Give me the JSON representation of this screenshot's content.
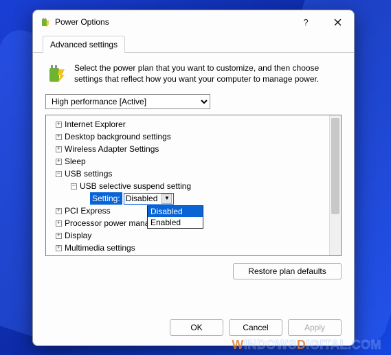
{
  "window": {
    "title": "Power Options"
  },
  "tab": {
    "label": "Advanced settings"
  },
  "description": "Select the power plan that you want to customize, and then choose settings that reflect how you want your computer to manage power.",
  "plan_select": {
    "value": "High performance [Active]"
  },
  "tree": {
    "items": [
      {
        "label": "Internet Explorer",
        "expanded": false,
        "depth": 0
      },
      {
        "label": "Desktop background settings",
        "expanded": false,
        "depth": 0
      },
      {
        "label": "Wireless Adapter Settings",
        "expanded": false,
        "depth": 0
      },
      {
        "label": "Sleep",
        "expanded": false,
        "depth": 0
      },
      {
        "label": "USB settings",
        "expanded": true,
        "depth": 0
      },
      {
        "label": "USB selective suspend setting",
        "expanded": true,
        "depth": 1
      },
      {
        "label": "PCI Express",
        "expanded": false,
        "depth": 0
      },
      {
        "label": "Processor power management",
        "expanded": false,
        "depth": 0
      },
      {
        "label": "Display",
        "expanded": false,
        "depth": 0
      },
      {
        "label": "Multimedia settings",
        "expanded": false,
        "depth": 0
      }
    ],
    "setting_row": {
      "label": "Setting:",
      "value": "Disabled"
    }
  },
  "dropdown": {
    "options": [
      "Disabled",
      "Enabled"
    ],
    "selected": "Disabled"
  },
  "buttons": {
    "restore": "Restore plan defaults",
    "ok": "OK",
    "cancel": "Cancel",
    "apply": "Apply"
  },
  "watermark": {
    "part1": "W",
    "part2": "INDOWS",
    "part3": "D",
    "part4": "IGITAL.COM"
  }
}
